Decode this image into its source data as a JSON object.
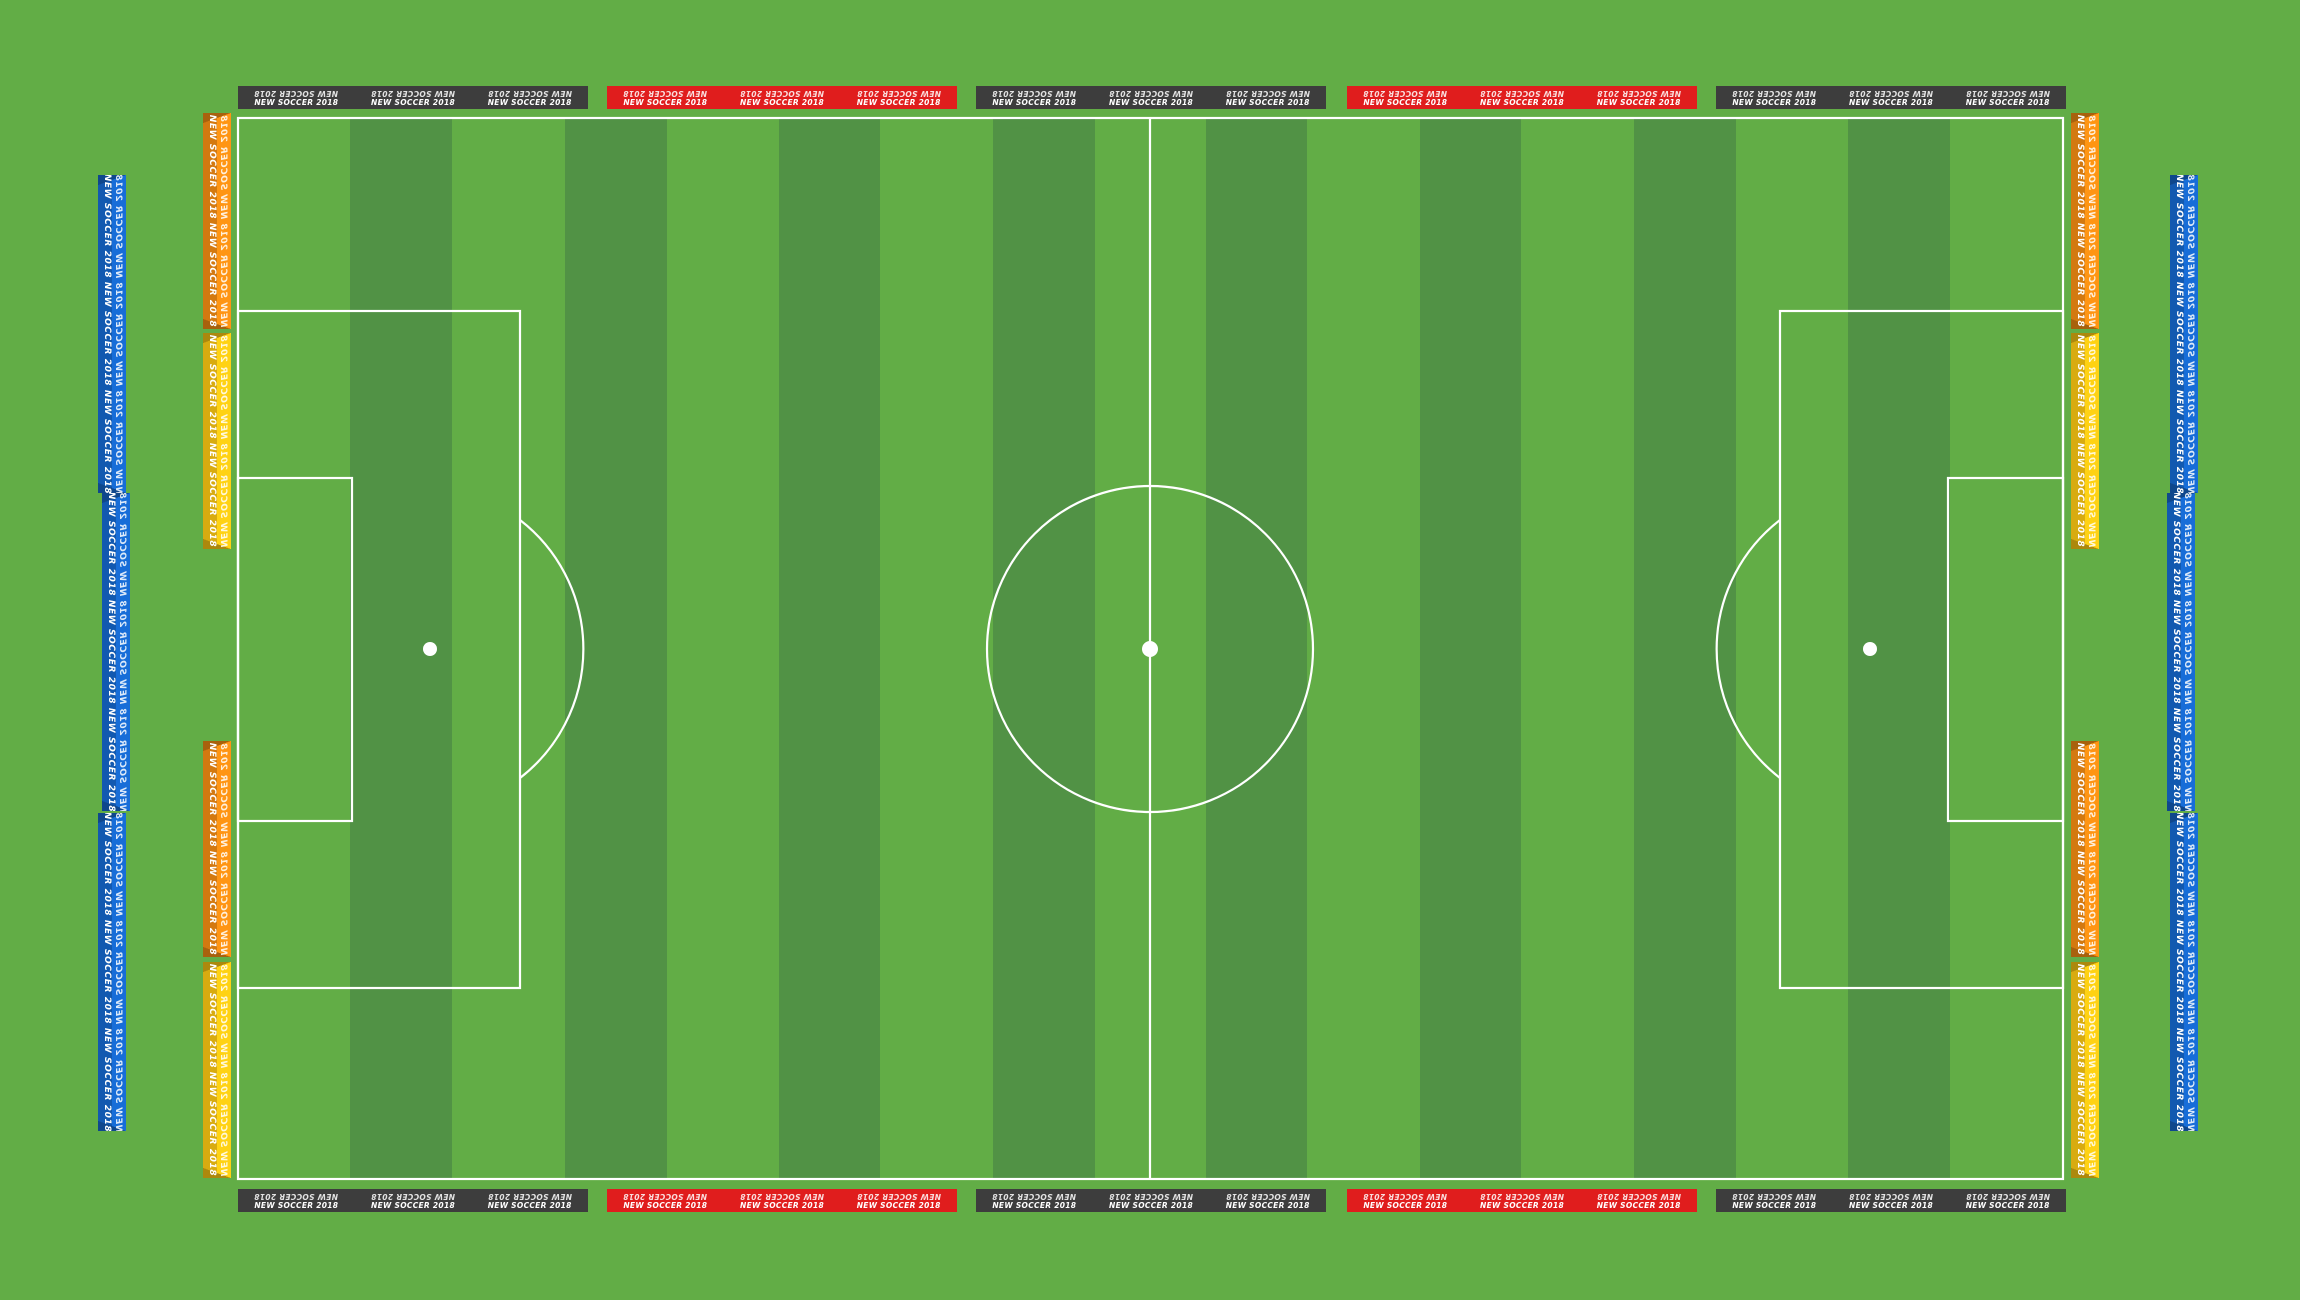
{
  "banner_text": {
    "line_top": "NEW SOCCER 2018",
    "line_bottom": "NEW SOCCER 2018"
  },
  "colors": {
    "grass_outer": "#62ad46",
    "stripe_light": "#62ad46",
    "stripe_dark": "#519245",
    "lines": "#ffffff",
    "banner_dark": "#3d3d3d",
    "banner_red": "#e01d1d",
    "banner_orange": "#f08a12",
    "banner_yellow": "#f5c212",
    "banner_blue": "#1565c8"
  },
  "top_banners": [
    {
      "color": "banner_dark"
    },
    {
      "color": "banner_red"
    },
    {
      "color": "banner_dark"
    },
    {
      "color": "banner_red"
    },
    {
      "color": "banner_dark"
    }
  ],
  "bottom_banners": [
    {
      "color": "banner_dark"
    },
    {
      "color": "banner_red"
    },
    {
      "color": "banner_dark"
    },
    {
      "color": "banner_red"
    },
    {
      "color": "banner_dark"
    }
  ],
  "left_inner_banners": [
    "banner_orange",
    "banner_yellow",
    "banner_orange",
    "banner_yellow"
  ],
  "right_inner_banners": [
    "banner_orange",
    "banner_yellow",
    "banner_orange",
    "banner_yellow"
  ],
  "left_outer_banners": [
    "banner_blue",
    "banner_blue",
    "banner_blue"
  ],
  "right_outer_banners": [
    "banner_blue",
    "banner_blue",
    "banner_blue"
  ]
}
